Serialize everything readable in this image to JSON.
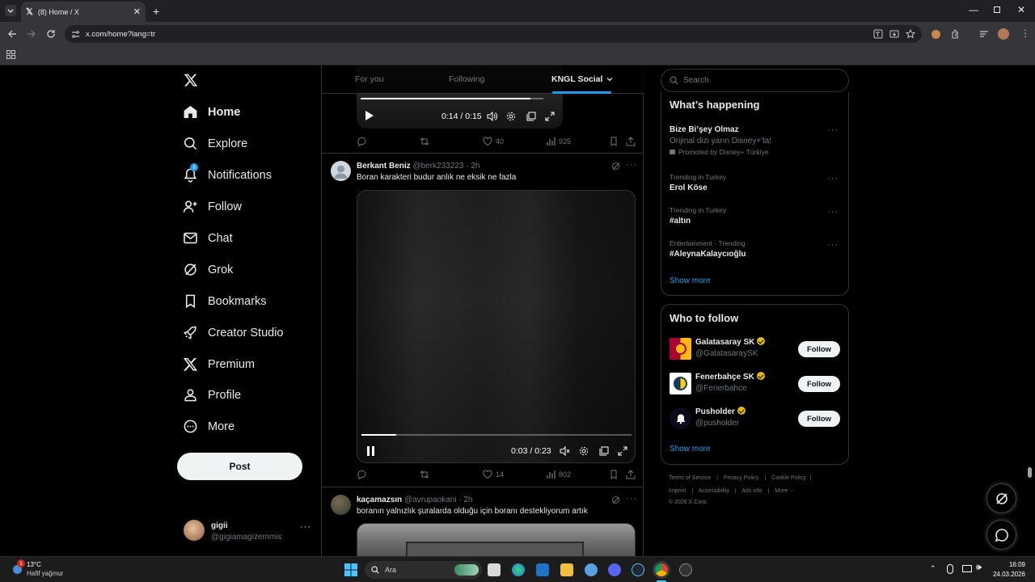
{
  "browser": {
    "tab_title": "(8) Home / X",
    "url": "x.com/home?lang=tr"
  },
  "nav": {
    "items": [
      {
        "label": "Home",
        "icon": "home-icon"
      },
      {
        "label": "Explore",
        "icon": "search-icon"
      },
      {
        "label": "Notifications",
        "icon": "bell-icon",
        "badge": "8"
      },
      {
        "label": "Follow",
        "icon": "person-plus-icon"
      },
      {
        "label": "Chat",
        "icon": "envelope-icon"
      },
      {
        "label": "Grok",
        "icon": "grok-icon"
      },
      {
        "label": "Bookmarks",
        "icon": "bookmark-icon"
      },
      {
        "label": "Creator Studio",
        "icon": "rocket-icon"
      },
      {
        "label": "Premium",
        "icon": "x-logo-icon"
      },
      {
        "label": "Profile",
        "icon": "person-icon"
      },
      {
        "label": "More",
        "icon": "more-circle-icon"
      }
    ],
    "post_label": "Post",
    "account": {
      "name": "gigii",
      "handle": "@gigiamagizemmis"
    }
  },
  "feed": {
    "tabs": [
      "For you",
      "Following",
      "KNGL Social"
    ],
    "active_tab": "KNGL Social",
    "top_video": {
      "time": "0:14 / 0:15",
      "progress": 0.93
    },
    "top_actions": {
      "replies": "",
      "reposts": "",
      "likes": "40",
      "views": "925"
    },
    "tweets": [
      {
        "name": "Berkant Beniz",
        "handle": "@berk233223",
        "time": "· 2h",
        "text": "Boran karakteri budur anlık ne eksik ne fazla",
        "video_time": "0:03 / 0:23",
        "video_progress": 0.13,
        "likes": "14",
        "views": "802"
      },
      {
        "name": "kaçamazsın",
        "handle": "@avrupaokani",
        "time": "· 2h",
        "text": "boranın yalnızlık şuralarda olduğu için boranı destekliyorum artık"
      }
    ]
  },
  "sidebar": {
    "search_placeholder": "Search",
    "happening_title": "What’s happening",
    "trends": [
      {
        "meta": "",
        "name": "Bize Bi’şey Olmaz",
        "desc": "Orijinal dizi yarın Disney+'ta!",
        "promo": "Promoted by Disney+ Türkiye"
      },
      {
        "meta": "Trending in Turkey",
        "name": "Erol Köse"
      },
      {
        "meta": "Trending in Turkey",
        "name": "#altın"
      },
      {
        "meta": "Entertainment · Trending",
        "name": "#AleynaKalaycıoğlu"
      }
    ],
    "show_more": "Show more",
    "who_title": "Who to follow",
    "follow_label": "Follow",
    "who": [
      {
        "name": "Galatasaray SK",
        "handle": "@GalatasaraySK"
      },
      {
        "name": "Fenerbahçe SK",
        "handle": "@Fenerbahce"
      },
      {
        "name": "Pusholder",
        "handle": "@pusholder"
      }
    ],
    "footer": [
      "Terms of Service",
      "Privacy Policy",
      "Cookie Policy",
      "Imprint",
      "Accessibility",
      "Ads info",
      "More ···",
      "© 2026 X Corp."
    ]
  },
  "taskbar": {
    "weather_temp": "13°C",
    "weather_desc": "Hafif yağmur",
    "weather_badge": "1",
    "search_label": "Ara",
    "time": "16:09",
    "date": "24.03.2026"
  },
  "colors": {
    "accent": "#1d9bf0",
    "bg": "#000000",
    "border": "#2f3336",
    "muted": "#71767b",
    "verified": "#e2b719"
  }
}
